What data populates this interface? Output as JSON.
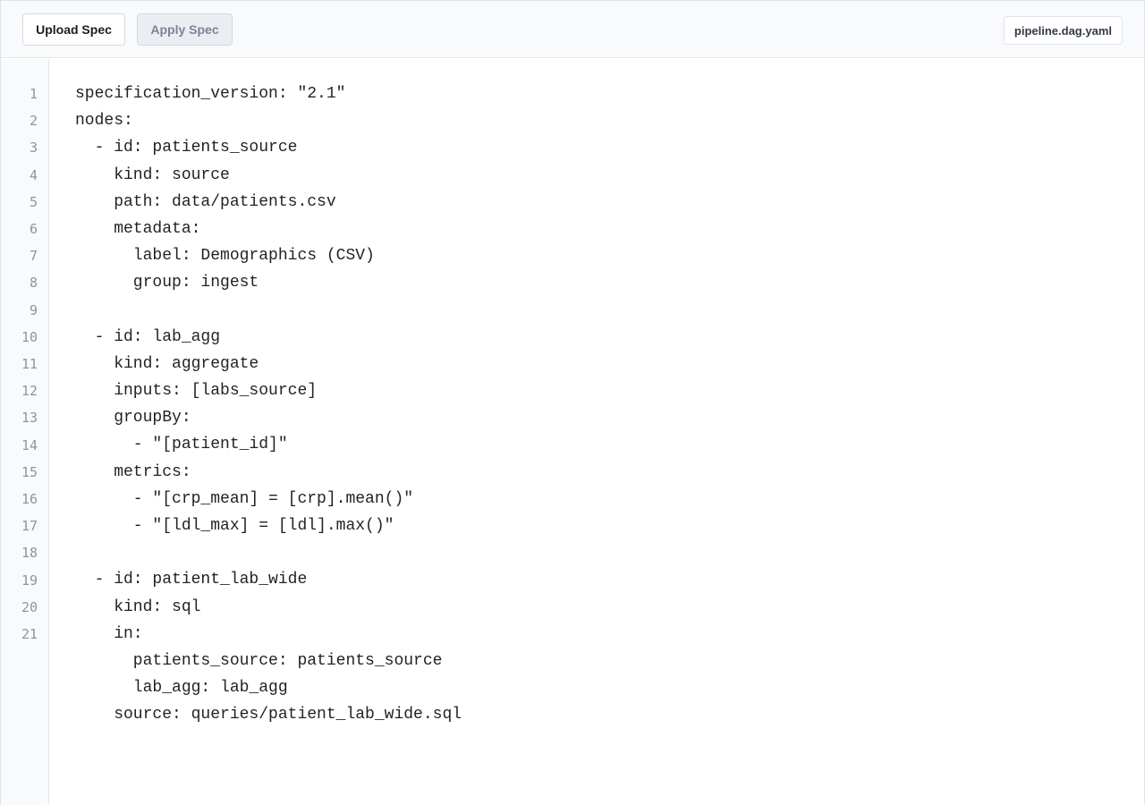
{
  "toolbar": {
    "upload_label": "Upload Spec",
    "apply_label": "Apply Spec",
    "filename": "pipeline.dag.yaml"
  },
  "editor": {
    "line_numbers": [
      "1",
      "2",
      "3",
      "4",
      "5",
      "6",
      "7",
      "8",
      "9",
      "10",
      "11",
      "12",
      "13",
      "14",
      "15",
      "16",
      "17",
      "18",
      "19",
      "20",
      "21"
    ],
    "lines": [
      "specification_version: \"2.1\"",
      "nodes:",
      "  - id: patients_source",
      "    kind: source",
      "    path: data/patients.csv",
      "    metadata:",
      "      label: Demographics (CSV)",
      "      group: ingest",
      "",
      "  - id: lab_agg",
      "    kind: aggregate",
      "    inputs: [labs_source]",
      "    groupBy:",
      "      - \"[patient_id]\"",
      "    metrics:",
      "      - \"[crp_mean] = [crp].mean()\"",
      "      - \"[ldl_max] = [ldl].max()\"",
      "",
      "  - id: patient_lab_wide",
      "    kind: sql",
      "    in:",
      "      patients_source: patients_source",
      "      lab_agg: lab_agg",
      "    source: queries/patient_lab_wide.sql"
    ]
  },
  "colors": {
    "toolbar_bg": "#f8fafc",
    "gutter_bg": "#f8fafc",
    "line_number": "#8b95a3",
    "code_text": "#1e2228",
    "apply_disabled_text": "#7a8494"
  }
}
